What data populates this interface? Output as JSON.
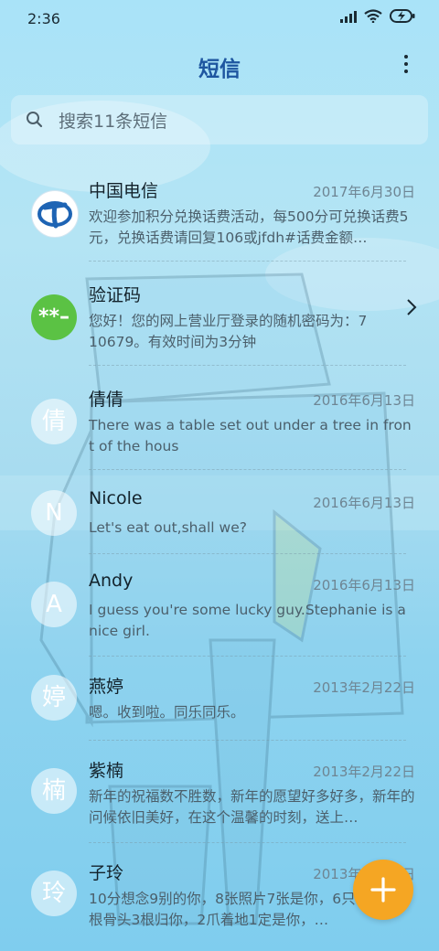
{
  "status_bar": {
    "time": "2:36"
  },
  "header": {
    "title": "短信"
  },
  "search": {
    "placeholder": "搜索11条短信"
  },
  "conversations": [
    {
      "name": "中国电信",
      "date": "2017年6月30日",
      "preview": "欢迎参加积分兑换话费活动，每500分可兑换话费5元，兑换话费请回复106或jfdh#话费金额…",
      "avatar_icon": "china-telecom-logo-icon"
    },
    {
      "name": "验证码",
      "date": "",
      "preview": "您好！您的网上营业厅登录的随机密码为：710679。有效时间为3分钟",
      "avatar_text": "**–"
    },
    {
      "name": "倩倩",
      "date": "2016年6月13日",
      "preview": "There was a table set out under a tree in front of the hous",
      "avatar_text": "倩"
    },
    {
      "name": "Nicole",
      "date": "2016年6月13日",
      "preview": "Let's eat out,shall we?",
      "avatar_text": "N"
    },
    {
      "name": "Andy",
      "date": "2016年6月13日",
      "preview": "I guess you're some lucky guy.Stephanie is a nice girl.",
      "avatar_text": "A"
    },
    {
      "name": "燕婷",
      "date": "2013年2月22日",
      "preview": "嗯。收到啦。同乐同乐。",
      "avatar_text": "婷"
    },
    {
      "name": "紫楠",
      "date": "2013年2月22日",
      "preview": "新年的祝福数不胜数，新年的愿望好多好多，新年的问候依旧美好，在这个温馨的时刻，送上…",
      "avatar_text": "楠"
    },
    {
      "name": "子玲",
      "date": "2013年2月22日",
      "preview": "10分想念9别的你，8张照片7张是你，6只像你，4根骨头3根归你，2爪着地1定是你，…",
      "avatar_text": "玲"
    }
  ],
  "colors": {
    "title": "#1e56a0",
    "fab": "#f5a623",
    "verify_avatar": "#5bc244",
    "telecom_blue": "#1e64b4"
  }
}
